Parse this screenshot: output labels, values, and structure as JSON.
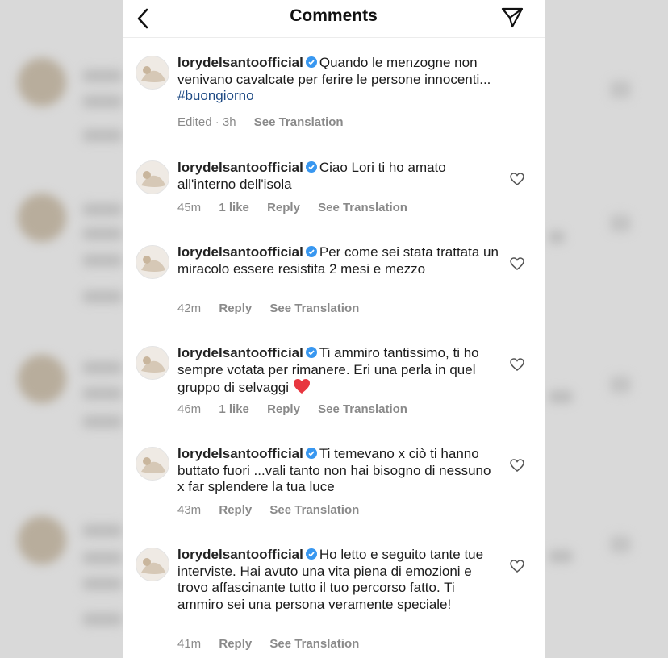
{
  "header": {
    "title": "Comments"
  },
  "caption": {
    "username": "lorydelsantoofficial",
    "text": "Quando le menzogne non venivano cavalcate per ferire le persone innocenti...",
    "hashtag": "#buongiorno",
    "meta_time": "Edited · 3h",
    "see_translation": "See Translation"
  },
  "comments": [
    {
      "username": "lorydelsantoofficial",
      "text": "Ciao Lori ti ho amato all'interno dell'isola",
      "time": "45m",
      "likes": "1 like",
      "reply": "Reply",
      "see_translation": "See Translation"
    },
    {
      "username": "lorydelsantoofficial",
      "text": "Per come sei stata trattata un miracolo essere resistita 2 mesi e mezzo",
      "time": "42m",
      "reply": "Reply",
      "see_translation": "See Translation"
    },
    {
      "username": "lorydelsantoofficial",
      "text": "Ti ammiro tantissimo, ti ho sempre votata per rimanere. Eri una perla in quel gruppo di selvaggi",
      "time": "46m",
      "likes": "1 like",
      "reply": "Reply",
      "see_translation": "See Translation"
    },
    {
      "username": "lorydelsantoofficial",
      "text": "Ti temevano x ciò ti hanno buttato fuori ...vali tanto non hai bisogno di nessuno x far splendere la tua luce",
      "time": "43m",
      "reply": "Reply",
      "see_translation": "See Translation"
    },
    {
      "username": "lorydelsantoofficial",
      "text": "Ho letto e seguito tante tue interviste. Hai avuto una vita piena di emozioni e trovo affascinante tutto il tuo percorso fatto. Ti ammiro sei una persona veramente speciale!",
      "time": "41m",
      "reply": "Reply",
      "see_translation": "See Translation"
    }
  ],
  "colors": {
    "hashtag": "#1e4a84",
    "verified": "#3897f0",
    "heart_emoji": "#e8363f"
  }
}
